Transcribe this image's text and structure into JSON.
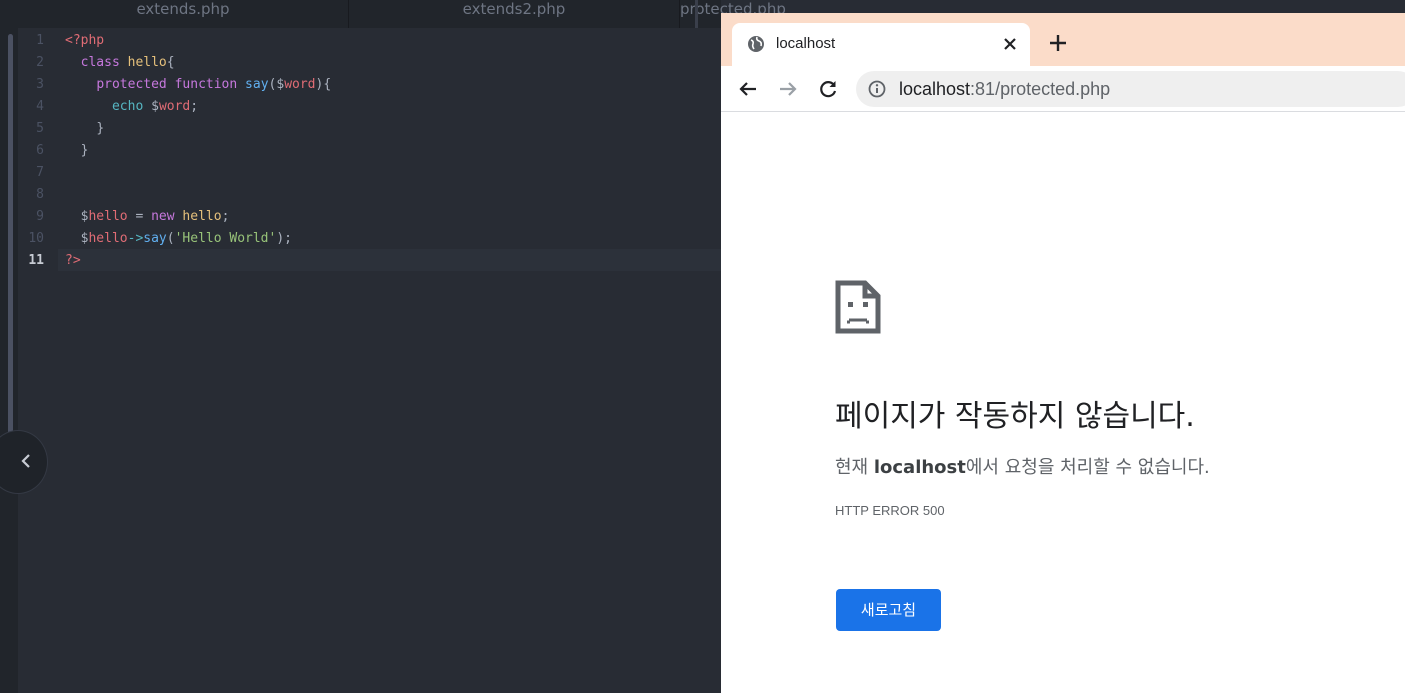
{
  "editor": {
    "tabs": [
      "extends.php",
      "extends2.php",
      "protected.php"
    ],
    "line_numbers": [
      "1",
      "2",
      "3",
      "4",
      "5",
      "6",
      "7",
      "8",
      "9",
      "10",
      "11"
    ],
    "code": {
      "l1_tag": "<?php",
      "l2_kw": "class",
      "l2_name": "hello",
      "l2_brace": "{",
      "l3_kw1": "protected",
      "l3_kw2": "function",
      "l3_fn": "say",
      "l3_p1": "(",
      "l3_dollar": "$",
      "l3_var": "word",
      "l3_p2": "){",
      "l4_echo": "echo",
      "l4_dollar": "$",
      "l4_var": "word",
      "l4_semi": ";",
      "l5": "}",
      "l6": "}",
      "l8_dollar": "$",
      "l8_var": "hello",
      "l8_eq": " = ",
      "l8_new": "new",
      "l8_cls": "hello",
      "l8_semi": ";",
      "l9_dollar": "$",
      "l9_var": "hello",
      "l9_arrow": "->",
      "l9_fn": "say",
      "l9_p1": "(",
      "l9_str": "'Hello World'",
      "l9_p2": ");",
      "l10_tag": "?>"
    }
  },
  "browser": {
    "tab_title": "localhost",
    "url_host": "localhost",
    "url_rest": ":81/protected.php",
    "error": {
      "heading": "페이지가 작동하지 않습니다.",
      "desc_prefix": "현재 ",
      "desc_host": "localhost",
      "desc_suffix": "에서 요청을 처리할 수 없습니다.",
      "code": "HTTP ERROR 500",
      "reload_button": "새로고침"
    }
  },
  "colors": {
    "editor_bg": "#282c34",
    "browser_tabstrip": "#fbdcc9",
    "reload_button": "#1a73e8"
  }
}
